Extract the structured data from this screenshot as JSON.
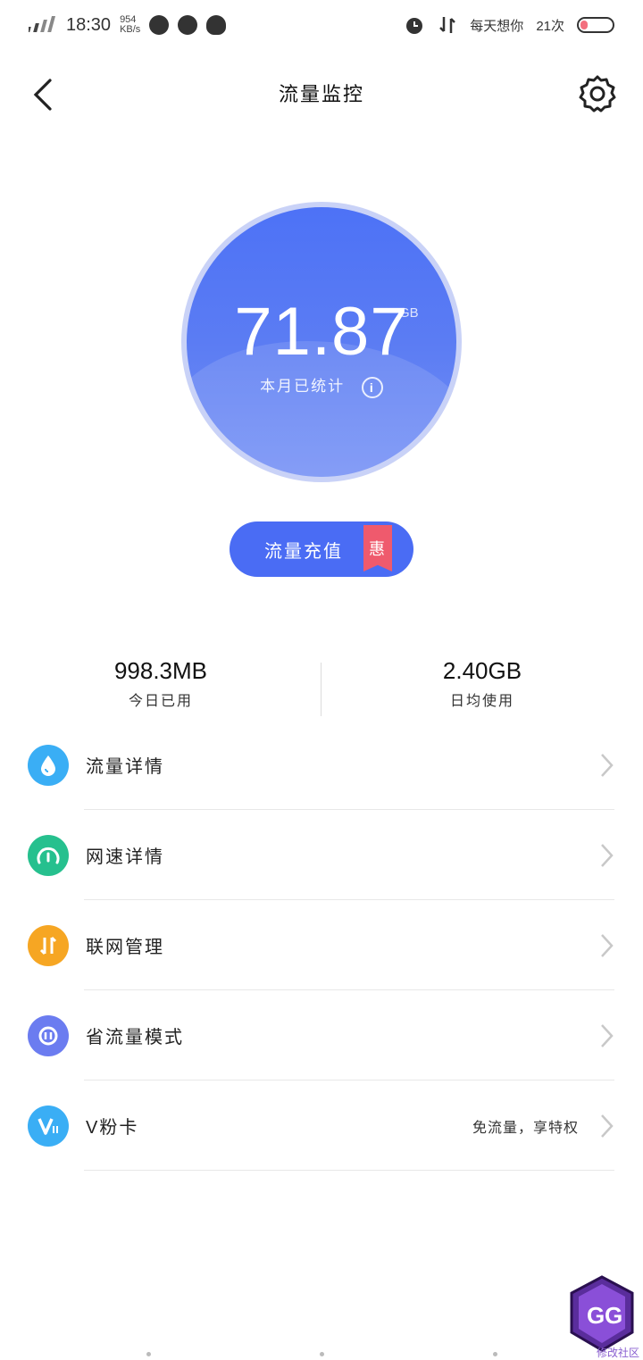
{
  "status_bar": {
    "time": "18:30",
    "net_speed_value": "954",
    "net_speed_unit": "KB/s",
    "reminder": "每天想你",
    "reminder_count": "21次",
    "icons": [
      "signal-icon",
      "browser-icon",
      "leaf-icon",
      "qq-icon",
      "alarm-icon",
      "data-transfer-icon",
      "battery-icon"
    ]
  },
  "header": {
    "title": "流量监控",
    "back_icon": "chevron-left-icon",
    "settings_icon": "gear-icon"
  },
  "gauge": {
    "value": "71.87",
    "unit": "GB",
    "caption": "本月已统计",
    "colors": {
      "outer": "#c9d2f7",
      "inner": "#4d72f6"
    }
  },
  "recharge": {
    "label": "流量充值",
    "badge": "惠"
  },
  "stats": {
    "today": {
      "value": "998.3MB",
      "label": "今日已用"
    },
    "daily_avg": {
      "value": "2.40GB",
      "label": "日均使用"
    }
  },
  "menu": [
    {
      "label": "流量详情",
      "icon": "water-drop-icon",
      "color": "#3aaef5",
      "extra": ""
    },
    {
      "label": "网速详情",
      "icon": "speedometer-icon",
      "color": "#26c08e",
      "extra": ""
    },
    {
      "label": "联网管理",
      "icon": "up-down-arrows-icon",
      "color": "#f6a623",
      "extra": ""
    },
    {
      "label": "省流量模式",
      "icon": "save-data-icon",
      "color": "#6b7cf0",
      "extra": ""
    },
    {
      "label": "V粉卡",
      "icon": "vfan-card-icon",
      "color": "#3aaef5",
      "extra": "免流量，享特权"
    }
  ],
  "watermark": {
    "caption": "修改社区"
  }
}
